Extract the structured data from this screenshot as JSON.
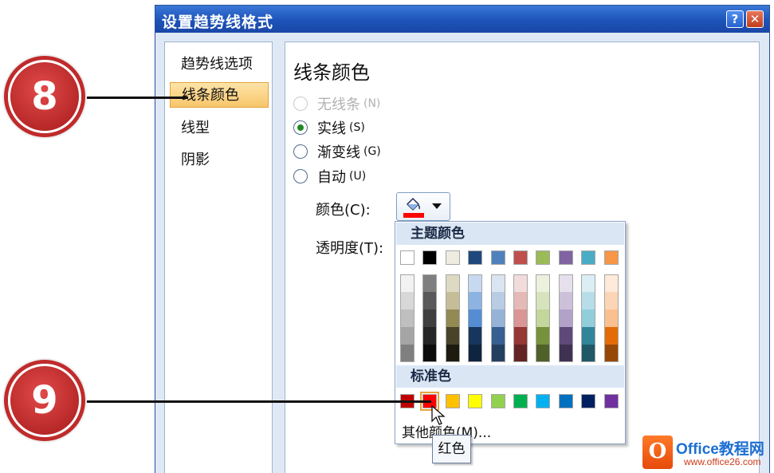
{
  "dialog": {
    "title": "设置趋势线格式",
    "help_icon": "help-icon",
    "close_icon": "close-icon"
  },
  "nav": {
    "items": [
      {
        "label": "趋势线选项",
        "selected": false
      },
      {
        "label": "线条颜色",
        "selected": true
      },
      {
        "label": "线型",
        "selected": false
      },
      {
        "label": "阴影",
        "selected": false
      }
    ]
  },
  "panel": {
    "title": "线条颜色",
    "options": [
      {
        "label": "无线条",
        "accel": "(N)",
        "checked": false,
        "disabled": true
      },
      {
        "label": "实线",
        "accel": "(S)",
        "checked": true,
        "disabled": false
      },
      {
        "label": "渐变线",
        "accel": "(G)",
        "checked": false,
        "disabled": false
      },
      {
        "label": "自动",
        "accel": "(U)",
        "checked": false,
        "disabled": false
      }
    ],
    "color_label": "颜色(C):",
    "transparency_label": "透明度(T):",
    "current_color": "#ff0000"
  },
  "palette": {
    "theme_header": "主题颜色",
    "theme_colors": [
      [
        "#ffffff",
        "#000000",
        "#eeece1",
        "#1f497d",
        "#4f81bd",
        "#c0504d",
        "#9bbb59",
        "#8064a2",
        "#4bacc6",
        "#f79646"
      ],
      [
        "#f2f2f2",
        "#7f7f7f",
        "#ddd9c3",
        "#c6d9f0",
        "#dbe5f1",
        "#f2dcdb",
        "#ebf1dd",
        "#e5e0ec",
        "#dbeef3",
        "#fdeada"
      ],
      [
        "#d8d8d8",
        "#595959",
        "#c4bd97",
        "#8db3e2",
        "#b8cce4",
        "#e5b9b7",
        "#d7e3bc",
        "#ccc1d9",
        "#b7dde8",
        "#fbd5b5"
      ],
      [
        "#bfbfbf",
        "#3f3f3f",
        "#938953",
        "#548dd4",
        "#95b3d7",
        "#d99694",
        "#c3d69b",
        "#b2a2c7",
        "#92cddc",
        "#fac08f"
      ],
      [
        "#a5a5a5",
        "#262626",
        "#494429",
        "#17365d",
        "#366092",
        "#953734",
        "#76923c",
        "#5f497a",
        "#31859b",
        "#e36c09"
      ],
      [
        "#7f7f7f",
        "#0c0c0c",
        "#1d1b10",
        "#0f243e",
        "#244061",
        "#632423",
        "#4f6128",
        "#3f3151",
        "#205867",
        "#974806"
      ]
    ],
    "standard_header": "标准色",
    "standard_colors": [
      "#c00000",
      "#ff0000",
      "#ffc000",
      "#ffff00",
      "#92d050",
      "#00b050",
      "#00b0f0",
      "#0070c0",
      "#002060",
      "#7030a0"
    ],
    "more_colors": "其他颜色(M)...",
    "tooltip": "红色"
  },
  "callouts": {
    "step8": "8",
    "step9": "9"
  },
  "watermark": {
    "logo": "O",
    "text1": "Office教程网",
    "text2": "www.office26.com"
  }
}
